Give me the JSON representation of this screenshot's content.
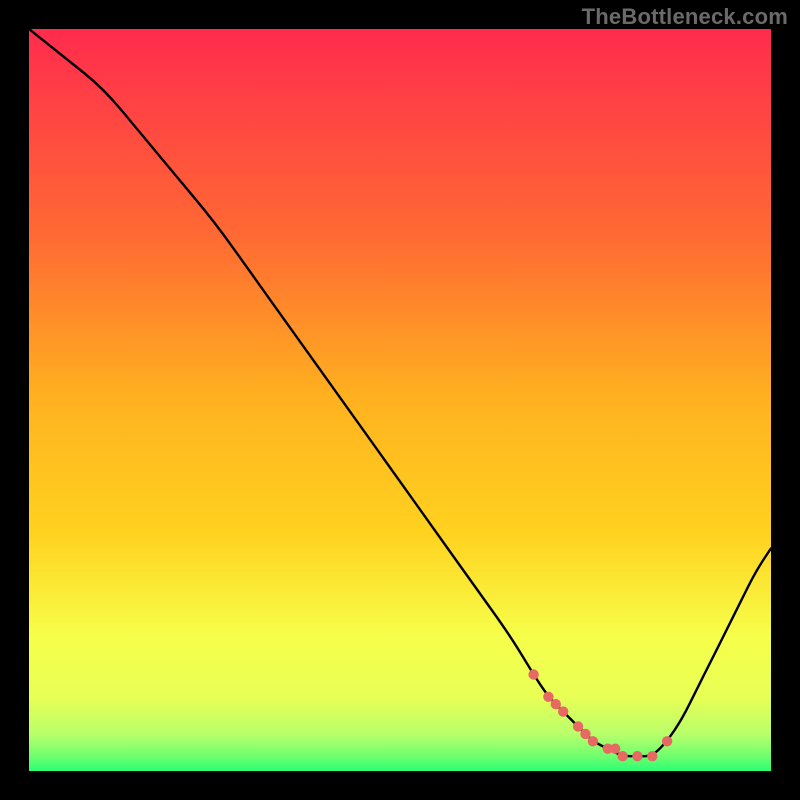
{
  "watermark": "TheBottleneck.com",
  "colors": {
    "frame": "#000000",
    "curve": "#000000",
    "marker": "#e66a63",
    "grad_top": "#ff2b4d",
    "grad_mid_upper": "#ff8a2a",
    "grad_mid": "#ffd21f",
    "grad_mid_lower": "#f6ff4a",
    "grad_green_light": "#b9ff6a",
    "grad_green": "#2cff73"
  },
  "chart_data": {
    "type": "line",
    "title": "",
    "xlabel": "",
    "ylabel": "",
    "xlim": [
      0,
      100
    ],
    "ylim": [
      0,
      100
    ],
    "series": [
      {
        "name": "bottleneck-curve",
        "x": [
          0,
          5,
          10,
          15,
          20,
          25,
          30,
          35,
          40,
          45,
          50,
          55,
          60,
          65,
          68,
          70,
          72,
          74,
          76,
          78,
          80,
          82,
          84,
          86,
          88,
          90,
          92,
          94,
          96,
          98,
          100
        ],
        "y": [
          100,
          96,
          92,
          86,
          80,
          74,
          67,
          60,
          53,
          46,
          39,
          32,
          25,
          18,
          13,
          10,
          8,
          6,
          4,
          3,
          2,
          2,
          2,
          4,
          7,
          11,
          15,
          19,
          23,
          27,
          30
        ]
      }
    ],
    "markers": {
      "name": "valley-points",
      "x": [
        68,
        70,
        71,
        72,
        74,
        75,
        76,
        78,
        79,
        80,
        82,
        84,
        86
      ],
      "y": [
        13,
        10,
        9,
        8,
        6,
        5,
        4,
        3,
        3,
        2,
        2,
        2,
        4
      ]
    }
  }
}
